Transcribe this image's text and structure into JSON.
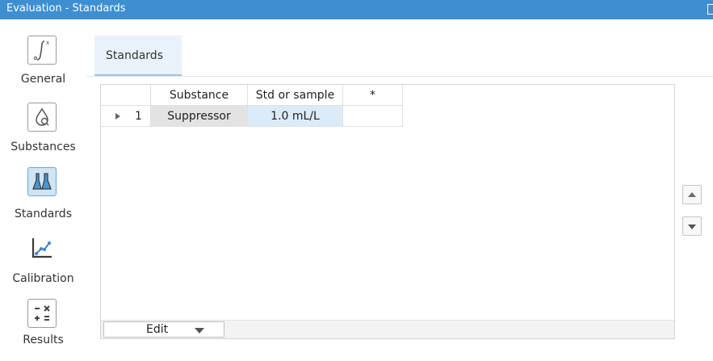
{
  "window": {
    "title": "Evaluation - Standards"
  },
  "sidebar": {
    "items": [
      {
        "label": "General",
        "icon": "integral-icon"
      },
      {
        "label": "Substances",
        "icon": "drop-search-icon"
      },
      {
        "label": "Standards",
        "icon": "flask-icon",
        "active": true
      },
      {
        "label": "Calibration",
        "icon": "calibration-curve-icon"
      },
      {
        "label": "Results",
        "icon": "calculator-icon"
      }
    ]
  },
  "tabs": [
    {
      "label": "Standards"
    }
  ],
  "table": {
    "headers": [
      "",
      "Substance",
      "Std or sample",
      "*"
    ],
    "rows": [
      {
        "index": "1",
        "substance": "Suppressor",
        "value": "1.0 mL/L",
        "star": ""
      }
    ]
  },
  "edit_button": {
    "label": "Edit"
  },
  "colors": {
    "title_bar": "#3d8fd1",
    "selected_cell": "#dcebf8",
    "active_nav": "#cfe4f5"
  }
}
